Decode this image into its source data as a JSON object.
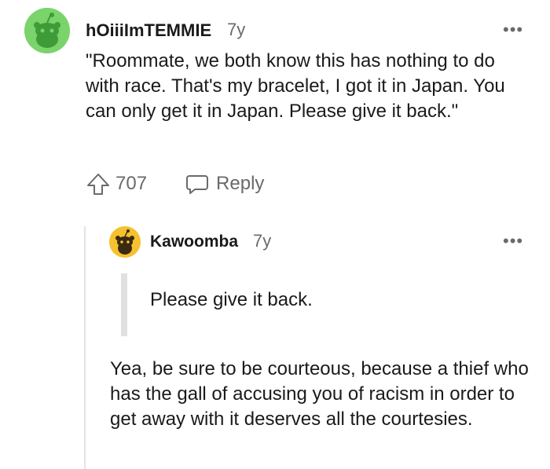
{
  "comments": [
    {
      "username": "hOiiiImTEMMIE",
      "age": "7y",
      "body": "\"Roommate, we both know this has nothing to do with race. That's my bracelet, I got it in Japan. You can only get it in Japan. Please give it back.\"",
      "score": "707",
      "reply_label": "Reply",
      "more_label": "•••",
      "avatar_color": "#7ad46b"
    },
    {
      "username": "Kawoomba",
      "age": "7y",
      "quote": "Please give it back.",
      "body": "Yea, be sure to be courteous, because a thief who has the gall of accusing you of racism in order to get away with it deserves all the courtesies.",
      "more_label": "•••",
      "avatar_color": "#f5c12e"
    }
  ],
  "colors": {
    "text": "#1a1a1b",
    "muted": "#6a6a6a",
    "thread_line": "#e3e3e3",
    "quote_bar": "#e0e0e0"
  }
}
